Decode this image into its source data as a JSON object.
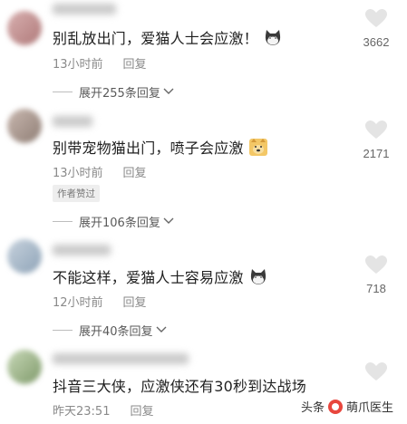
{
  "comments": [
    {
      "text": "别乱放出门，爱猫人士会应激！",
      "time": "13小时前",
      "reply_label": "回复",
      "expand": "展开255条回复",
      "likes": "3662"
    },
    {
      "text": "别带宠物猫出门，喷子会应激",
      "time": "13小时前",
      "reply_label": "回复",
      "author_tag": "作者赞过",
      "expand": "展开106条回复",
      "likes": "2171"
    },
    {
      "text": "不能这样，爱猫人士容易应激",
      "time": "12小时前",
      "reply_label": "回复",
      "expand": "展开40条回复",
      "likes": "718"
    },
    {
      "text": "抖音三大侠，应激侠还有30秒到达战场",
      "time": "昨天23:51",
      "reply_label": "回复",
      "likes": ""
    }
  ],
  "watermark": {
    "prefix": "头条",
    "account": "萌爪医生"
  },
  "colors": {
    "text": "#1f1f1f",
    "meta": "#8a8a8a",
    "accent_logo": "#e8463d"
  }
}
